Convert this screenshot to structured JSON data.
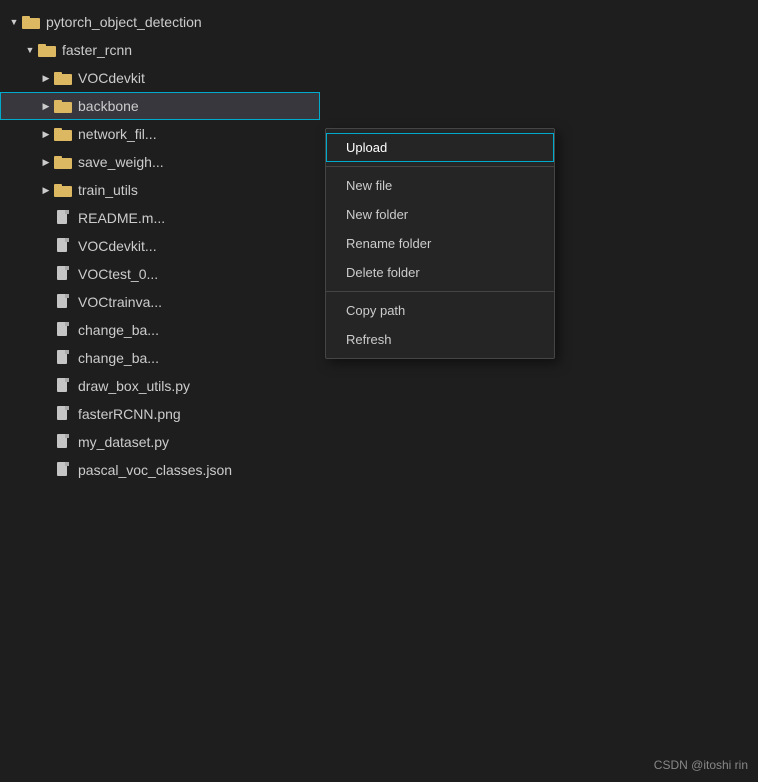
{
  "tree": {
    "items": [
      {
        "id": "pytorch",
        "label": "pytorch_object_detection",
        "type": "folder",
        "indent": 0,
        "expanded": true,
        "arrow": "down"
      },
      {
        "id": "faster_rcnn",
        "label": "faster_rcnn",
        "type": "folder",
        "indent": 1,
        "expanded": true,
        "arrow": "down"
      },
      {
        "id": "VOCdevkit",
        "label": "VOCdevkit",
        "type": "folder",
        "indent": 2,
        "expanded": false,
        "arrow": "right"
      },
      {
        "id": "backbone",
        "label": "backbone",
        "type": "folder",
        "indent": 2,
        "expanded": false,
        "arrow": "right",
        "selected": true
      },
      {
        "id": "network_fil",
        "label": "network_fil...",
        "type": "folder",
        "indent": 2,
        "expanded": false,
        "arrow": "right"
      },
      {
        "id": "save_weigh",
        "label": "save_weigh...",
        "type": "folder",
        "indent": 2,
        "expanded": false,
        "arrow": "right"
      },
      {
        "id": "train_utils",
        "label": "train_utils",
        "type": "folder",
        "indent": 2,
        "expanded": false,
        "arrow": "right"
      },
      {
        "id": "readme",
        "label": "README.m...",
        "type": "file",
        "indent": 2
      },
      {
        "id": "vocdevkit2",
        "label": "VOCdevkit...",
        "type": "file",
        "indent": 2
      },
      {
        "id": "voctest",
        "label": "VOCtest_0...",
        "type": "file",
        "indent": 2
      },
      {
        "id": "voctrainval",
        "label": "VOCtrainva...",
        "type": "file",
        "indent": 2
      },
      {
        "id": "change_ba1",
        "label": "change_ba...",
        "type": "file",
        "indent": 2
      },
      {
        "id": "change_ba2",
        "label": "change_ba...",
        "type": "file",
        "indent": 2
      },
      {
        "id": "draw_box",
        "label": "draw_box_utils.py",
        "type": "file",
        "indent": 2
      },
      {
        "id": "fasterrcnn",
        "label": "fasterRCNN.png",
        "type": "file",
        "indent": 2
      },
      {
        "id": "my_dataset",
        "label": "my_dataset.py",
        "type": "file",
        "indent": 2
      },
      {
        "id": "pascal_voc",
        "label": "pascal_voc_classes.json",
        "type": "file",
        "indent": 2
      }
    ]
  },
  "contextMenu": {
    "items": [
      {
        "id": "upload",
        "label": "Upload",
        "highlighted": true,
        "group": 1
      },
      {
        "id": "new-file",
        "label": "New file",
        "group": 1
      },
      {
        "id": "new-folder",
        "label": "New folder",
        "group": 1
      },
      {
        "id": "rename-folder",
        "label": "Rename folder",
        "group": 1
      },
      {
        "id": "delete-folder",
        "label": "Delete folder",
        "group": 1
      },
      {
        "id": "copy-path",
        "label": "Copy path",
        "group": 2
      },
      {
        "id": "refresh",
        "label": "Refresh",
        "group": 2
      }
    ]
  },
  "watermark": {
    "text": "CSDN @itoshi rin"
  }
}
